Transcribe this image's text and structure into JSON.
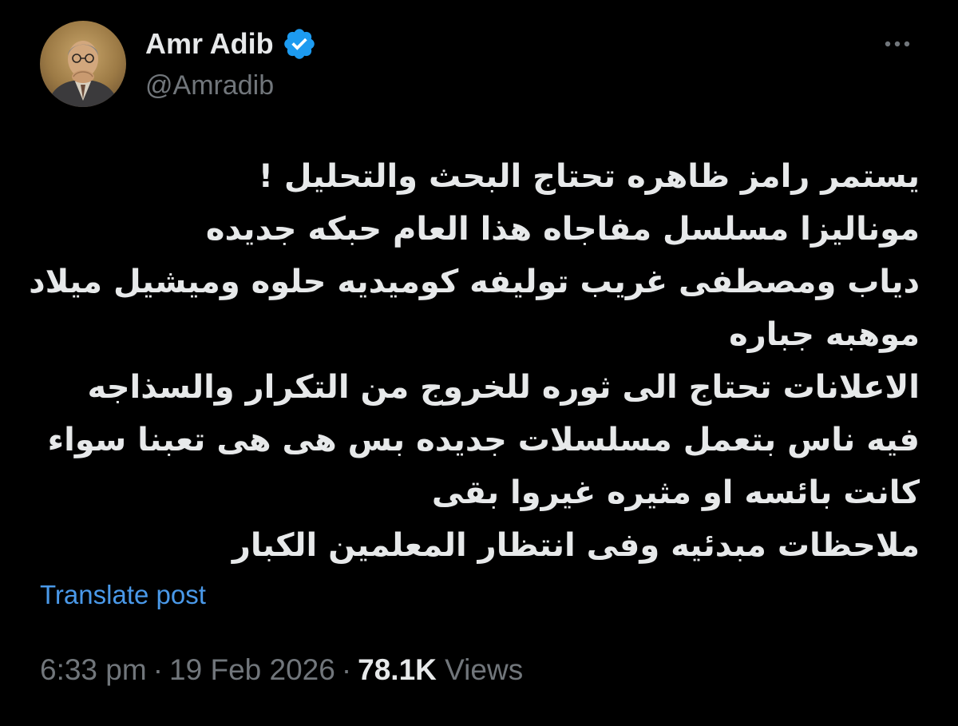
{
  "author": {
    "display_name": "Amr Adib",
    "handle": "@Amradib",
    "verified": true,
    "verified_color": "#1d9bf0",
    "avatar_icon": "portrait-avatar"
  },
  "menu": {
    "more_icon": "ellipsis-horizontal-icon"
  },
  "tweet": {
    "lines": [
      "يستمر رامز ظاهره تحتاج البحث والتحليل !",
      "موناليزا مسلسل مفاجاه هذا العام حبكه جديده",
      "دياب ومصطفى غريب توليفه كوميديه حلوه وميشيل ميلاد",
      "موهبه جباره",
      "الاعلانات تحتاج الى ثوره للخروج من التكرار والسذاجه",
      "فيه ناس بتعمل مسلسلات جديده بس هى هى تعبنا سواء",
      "كانت بائسه او مثيره غيروا بقى",
      "ملاحظات مبدئيه وفى انتظار المعلمين الكبار"
    ],
    "translate_label": "Translate post"
  },
  "meta": {
    "time": "6:33 pm",
    "separator": "·",
    "date": "19 Feb 2026",
    "views_count": "78.1K",
    "views_label": "Views"
  },
  "colors": {
    "background": "#000000",
    "text_primary": "#e7e9ea",
    "text_secondary": "#71767b",
    "link": "#4a99e9"
  }
}
